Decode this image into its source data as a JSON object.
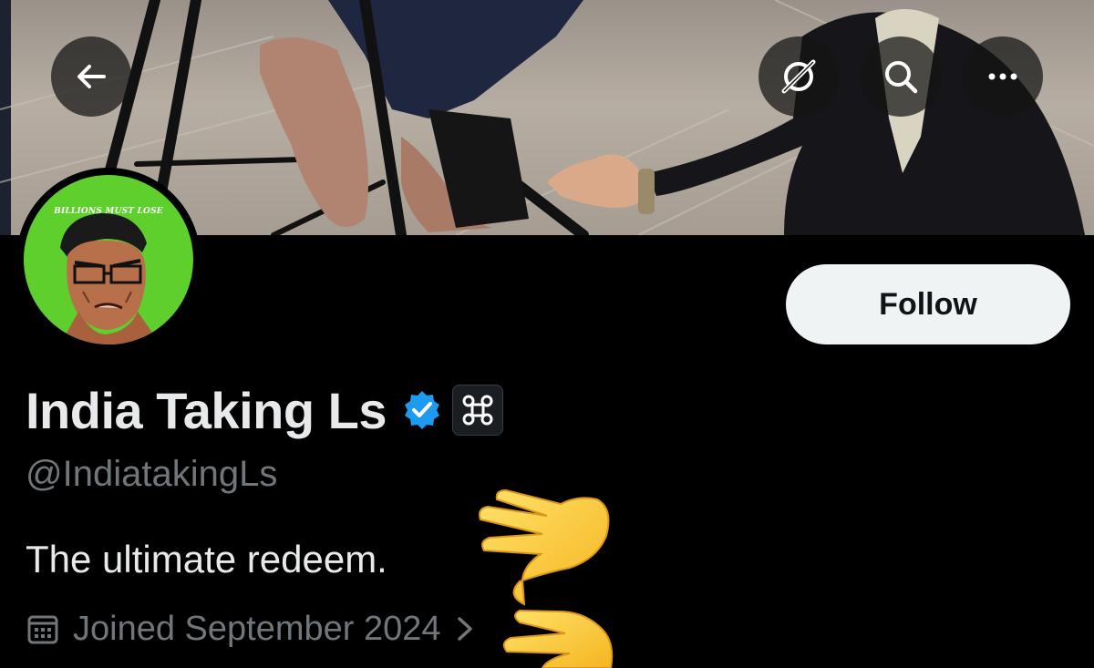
{
  "profile": {
    "display_name": "India Taking Ls",
    "handle": "@IndiatakingLs",
    "bio": "The ultimate redeem.",
    "joined": "Joined September 2024",
    "avatar_caption": "BILLIONS MUST LOSE"
  },
  "actions": {
    "follow_label": "Follow"
  },
  "icons": {
    "back": "arrow-left-icon",
    "grok": "grok-icon",
    "search": "search-icon",
    "more": "more-horizontal-icon",
    "verified": "verified-badge-icon",
    "affiliate": "command-key-icon",
    "calendar": "calendar-icon",
    "chevron": "chevron-right-icon",
    "hands": "raised-hand-emoji"
  },
  "colors": {
    "background": "#000000",
    "primary_text": "#e7e9ea",
    "secondary_text": "#71767b",
    "verified_blue": "#1d9bf0",
    "follow_bg": "#eff3f4",
    "avatar_green": "#5fcf2e"
  }
}
